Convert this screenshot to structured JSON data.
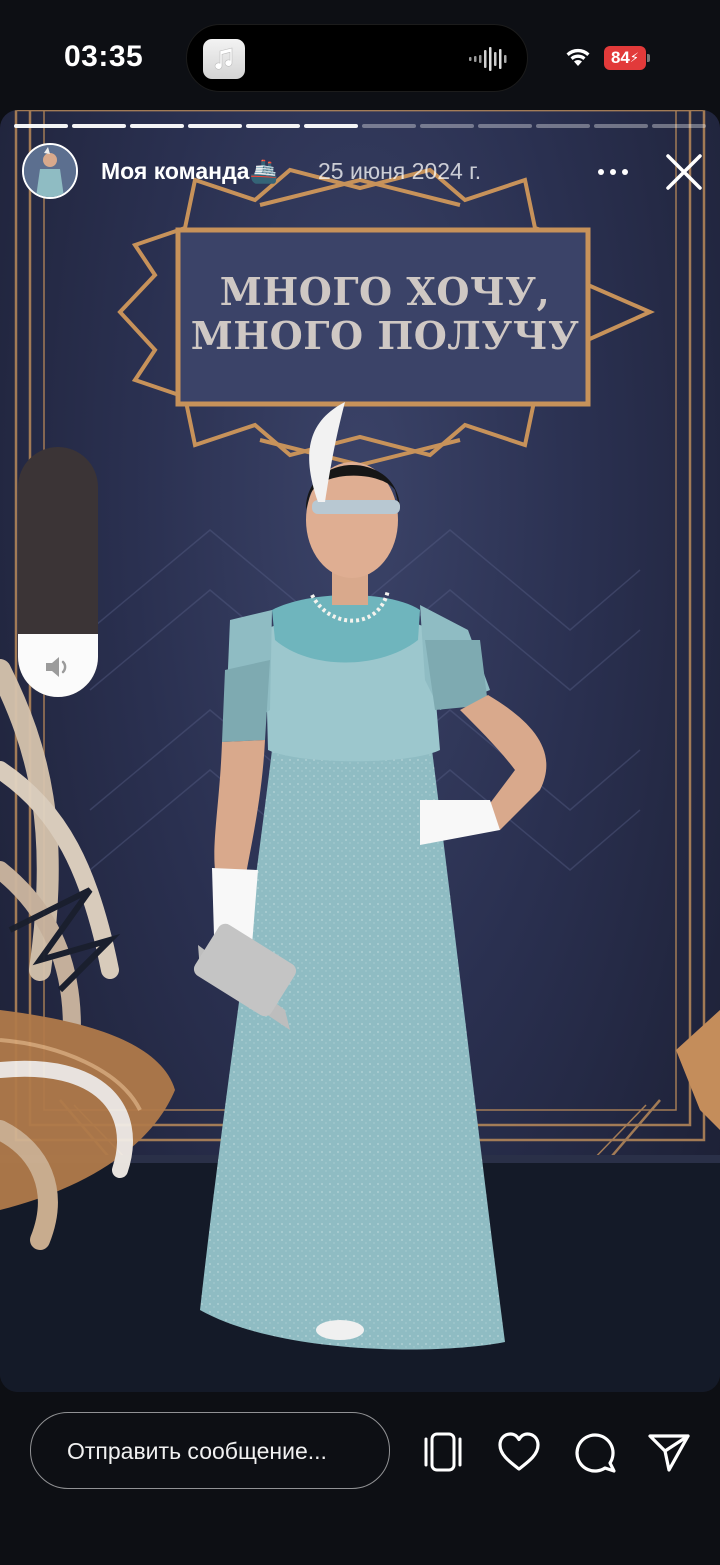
{
  "status_bar": {
    "time": "03:35",
    "battery_level": "84"
  },
  "story": {
    "username": "Моя команда🚢",
    "date": "25 июня 2024 г.",
    "sign_line1": "МНОГО ХОЧУ,",
    "sign_line2": "МНОГО ПОЛУЧУ",
    "progress": {
      "segments": 12,
      "current": 6
    },
    "volume_level": 0.25
  },
  "reply": {
    "placeholder": "Отправить сообщение..."
  },
  "icons": {
    "music_app": "music-note-icon",
    "wifi": "wifi-icon",
    "more": "more-dots-icon",
    "close": "close-icon",
    "speaker": "speaker-icon",
    "repost": "repost-icon",
    "like": "heart-icon",
    "comment": "comment-icon",
    "share": "send-icon"
  },
  "colors": {
    "battery_low": "#e23a3a",
    "dress": "#8fbcc3",
    "gold": "#c7925a"
  }
}
